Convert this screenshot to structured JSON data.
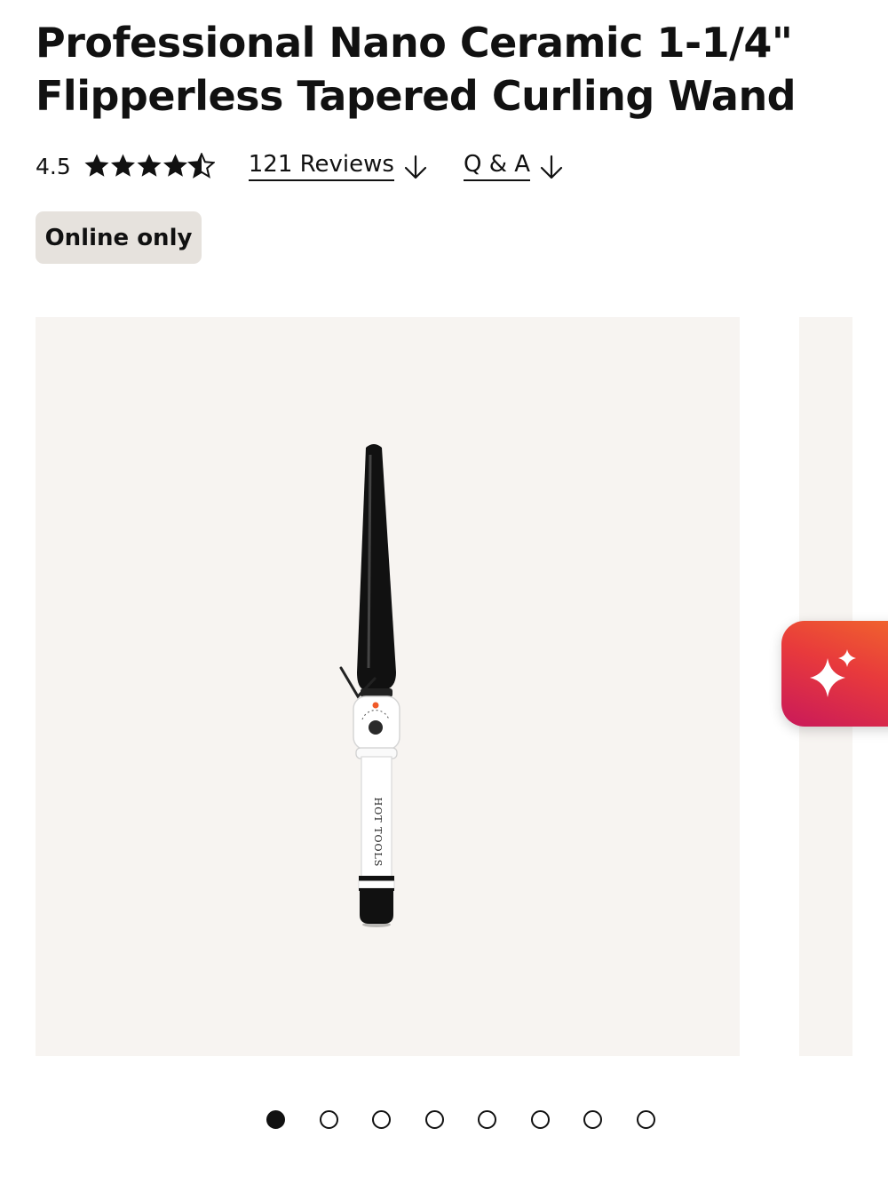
{
  "product": {
    "title_line1": "Professional Nano Ceramic 1-1/4\"",
    "title_line2": "Flipperless Tapered Curling Wand"
  },
  "rating": {
    "value": "4.5",
    "stars_filled": 4.5,
    "stars_total": 5
  },
  "links": {
    "reviews_label": "121 Reviews",
    "qa_label": "Q & A"
  },
  "badge": {
    "label": "Online only"
  },
  "gallery": {
    "image_icon": "curling-wand-image",
    "slide_count": 8,
    "active_slide": 1
  },
  "fab": {
    "icon": "sparkle-icon"
  },
  "colors": {
    "gallery_bg": "#f7f4f1",
    "badge_bg": "#e6e2dd",
    "fab_gradient_start": "#f1662c",
    "fab_gradient_end": "#c9195a"
  }
}
